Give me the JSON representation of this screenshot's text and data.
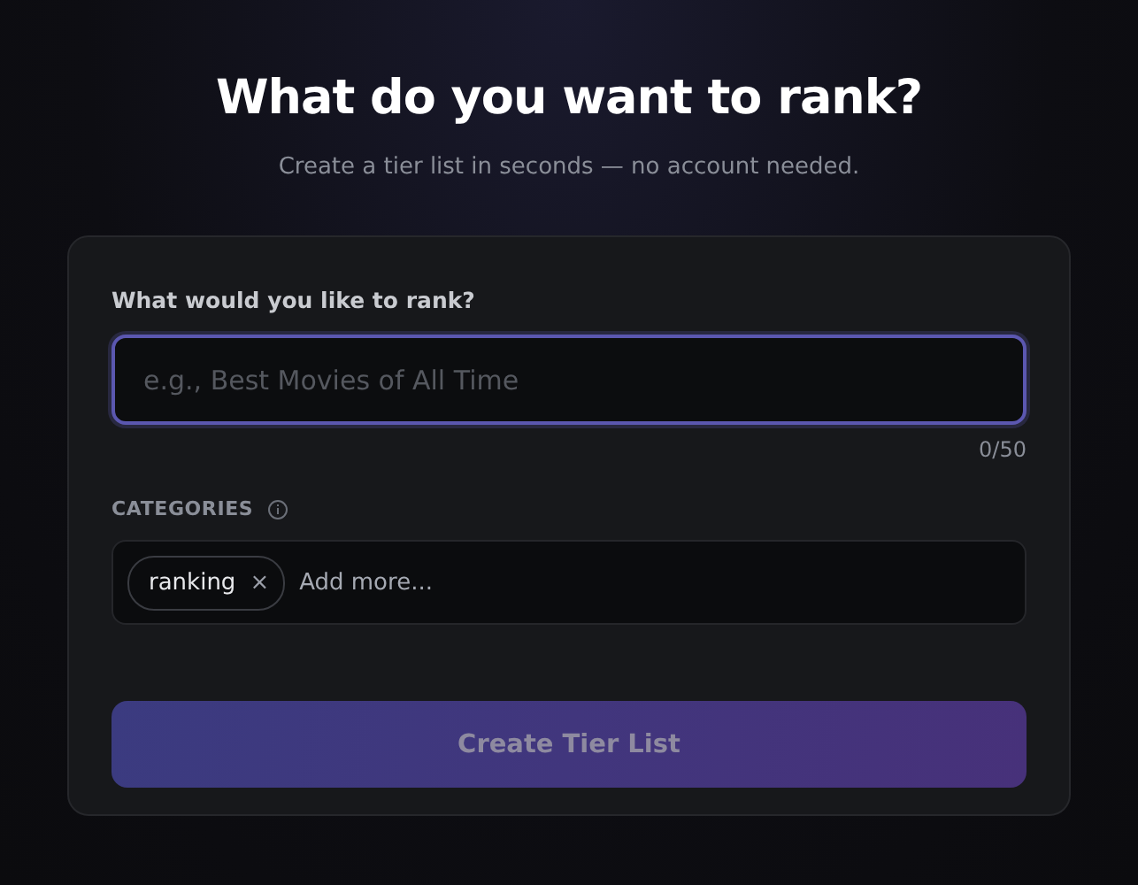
{
  "header": {
    "title": "What do you want to rank?",
    "subtitle": "Create a tier list in seconds — no account needed."
  },
  "form": {
    "topic": {
      "label": "What would you like to rank?",
      "placeholder": "e.g., Best Movies of All Time",
      "counter": "0/50",
      "focused": true
    },
    "categories": {
      "label": "CATEGORIES",
      "tags": [
        {
          "text": "ranking",
          "remove": "×"
        }
      ],
      "placeholder": "Add more..."
    },
    "submit": {
      "label": "Create Tier List",
      "disabled": true
    }
  }
}
